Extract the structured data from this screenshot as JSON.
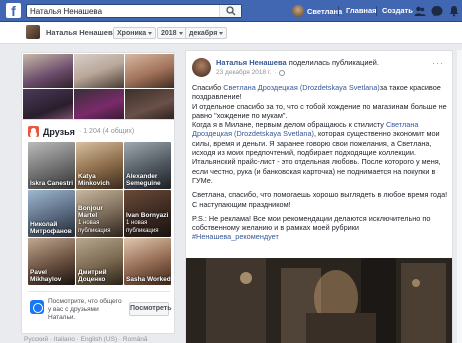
{
  "topbar": {
    "logo": "f",
    "search_value": "Наталья Ненашева",
    "user_name": "Светлана",
    "home_label": "Главная",
    "create_label": "Создать",
    "colors": {
      "brand": "#4267b2"
    }
  },
  "subbar": {
    "name": "Наталья Ненашева",
    "timeline": "Хроника",
    "year": "2018",
    "month": "декабря"
  },
  "friends": {
    "title": "Друзья",
    "count": "· 1 204 (4 общих)",
    "items": [
      {
        "name": "Iskra Canestri",
        "sub": ""
      },
      {
        "name": "Katya Minkovich",
        "sub": ""
      },
      {
        "name": "Alexander Semeguine",
        "sub": ""
      },
      {
        "name": "Николай Митрофанов",
        "sub": ""
      },
      {
        "name": "Bonjour Martel",
        "sub": "1 новая публикация"
      },
      {
        "name": "Ivan Bornyazi",
        "sub": "1 новая публикация"
      },
      {
        "name": "Pavel Mikhaylov",
        "sub": ""
      },
      {
        "name": "Дмитрий Доценко",
        "sub": ""
      },
      {
        "name": "Sasha Worked",
        "sub": ""
      }
    ],
    "notice_text": "Посмотрите, что общего у вас с друзьями Натальи.",
    "notice_button": "Посмотреть"
  },
  "footer": {
    "languages": "Русский · Italiano · English (US) · Română"
  },
  "post": {
    "author": "Наталья Ненашева",
    "action": "поделилась публикацией.",
    "date": "23 декабря 2018 г.",
    "para1_a": "Спасибо ",
    "para1_link": "Светлана Дроздецкая (Drozdetskaya Svetlana)",
    "para1_b": "за такое красивое поздравление!",
    "para2": "И отдельное спасибо за то, что с тобой хождение по магазинам больше не равно \"хождение по мукам\".",
    "para3_a": "Когда я в Милане, первым делом обращаюсь к стилисту ",
    "para3_link": "Светлана Дроздецкая (Drozdetskaya Svetlana)",
    "para3_b": ", которая существенно экономит мои силы, время и деньги. Я заранее говорю свои пожелания, а Светлана, исходя из моих предпочтений, подбирает подходящие коллекции. Итальянский прайс-лист - это отдельная любовь. После которого у меня, если честно, рука (и банковская карточка) не поднимается на покупки в ГУМе.",
    "para4": "Светлана, спасибо, что помогаешь хорошо выглядеть в любое время года! С наступающим праздником!",
    "para5": "P.S.: Не реклама! Все мои рекомендации делаются исключительно по собственному желанию и в рамках моей рубрики",
    "hashtag": "#Ненашева_рекомендует"
  }
}
